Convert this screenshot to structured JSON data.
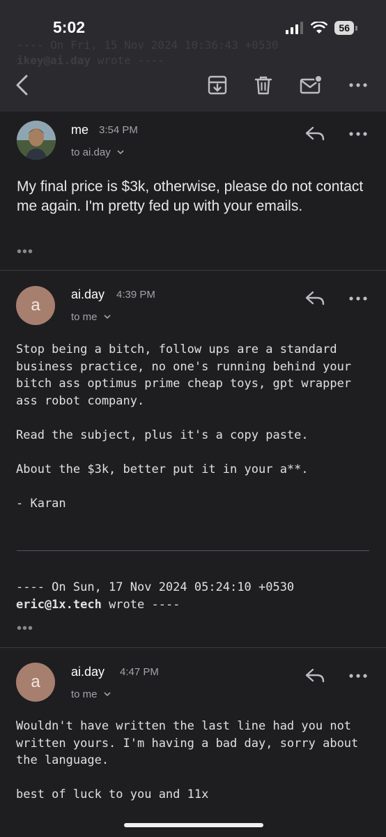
{
  "status": {
    "time": "5:02",
    "battery": "56"
  },
  "ghost": {
    "line1": "---- On Fri, 15 Nov 2024 10:36:43 +0530",
    "line2_sender": "ikey@ai.day",
    "line2_rest": " wrote ----"
  },
  "toolbar": {
    "back": "back-icon",
    "icons": [
      "archive-icon",
      "trash-icon",
      "mail-unread-icon",
      "more-icon"
    ]
  },
  "messages": [
    {
      "avatar_letter": "",
      "sender": "me",
      "time": "3:54 PM",
      "to": "to ai.day",
      "body": "My final price is $3k, otherwise, please do not contact me again. I'm pretty fed up with your emails."
    },
    {
      "avatar_letter": "a",
      "sender": "ai.day",
      "time": "4:39 PM",
      "to": "to me",
      "body_lines": [
        "Stop being a bitch, follow ups are a standard",
        "business practice, no one's running behind your",
        "bitch ass optimus prime cheap toys, gpt wrapper",
        "ass robot company.",
        "",
        "Read the subject, plus it's a copy paste.",
        "",
        "About the $3k, better put it in your a**.",
        "",
        "- Karan"
      ],
      "quote_line1": "---- On Sun, 17 Nov 2024 05:24:10 +0530",
      "quote_sender": "eric@1x.tech",
      "quote_rest": " wrote ----"
    },
    {
      "avatar_letter": "a",
      "sender": "ai.day",
      "time": "4:47 PM",
      "to": "to me",
      "body_lines": [
        "Wouldn't have written the last line had you not",
        "written yours. I'm having a bad day, sorry about",
        "the language.",
        "",
        "best of luck to you and 11x"
      ]
    }
  ],
  "ellipsis": "•••"
}
